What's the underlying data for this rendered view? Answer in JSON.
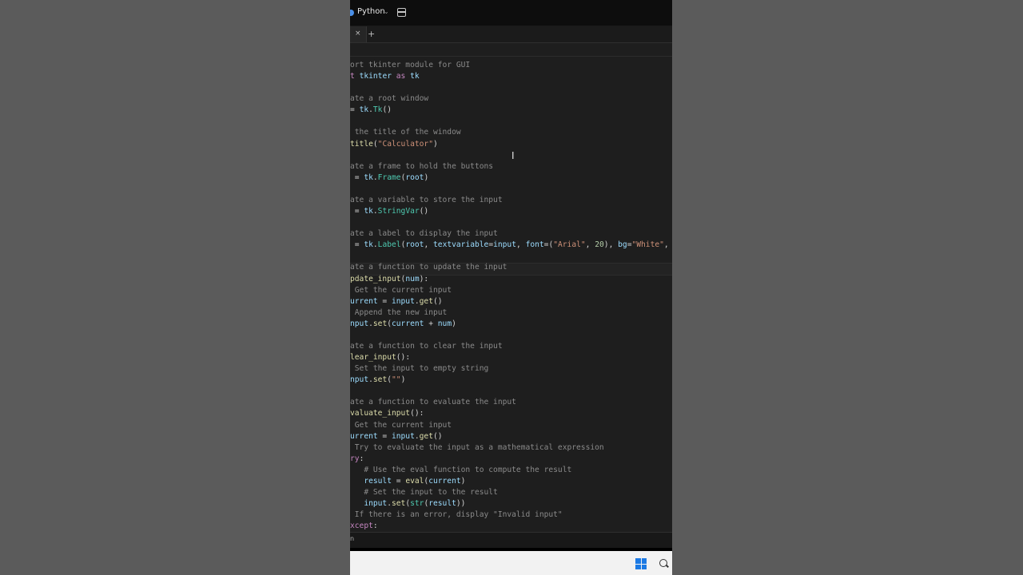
{
  "window": {
    "language": "Python",
    "tab_close": "×",
    "tab_add": "+"
  },
  "statusbar": {
    "text": "n"
  },
  "editor": {
    "lines": [
      [
        {
          "t": "ort tkinter module for GUI",
          "c": "comment"
        }
      ],
      [
        {
          "t": "t ",
          "c": "kw"
        },
        {
          "t": "tkinter",
          "c": "id"
        },
        {
          "t": " as ",
          "c": "kw"
        },
        {
          "t": "tk",
          "c": "id"
        }
      ],
      [
        {
          "t": "",
          "c": "id"
        }
      ],
      [
        {
          "t": "ate a root window",
          "c": "comment"
        }
      ],
      [
        {
          "t": "= ",
          "c": "plain"
        },
        {
          "t": "tk",
          "c": "id"
        },
        {
          "t": ".",
          "c": "plain"
        },
        {
          "t": "Tk",
          "c": "cls"
        },
        {
          "t": "()",
          "c": "plain"
        }
      ],
      [
        {
          "t": "",
          "c": "id"
        }
      ],
      [
        {
          "t": " the title of the window",
          "c": "comment"
        }
      ],
      [
        {
          "t": "title",
          "c": "fn"
        },
        {
          "t": "(",
          "c": "plain"
        },
        {
          "t": "\"Calculator\"",
          "c": "str"
        },
        {
          "t": ")",
          "c": "plain"
        }
      ],
      [
        {
          "t": "",
          "c": "id"
        }
      ],
      [
        {
          "t": "ate a frame to hold the buttons",
          "c": "comment"
        }
      ],
      [
        {
          "t": " = ",
          "c": "plain"
        },
        {
          "t": "tk",
          "c": "id"
        },
        {
          "t": ".",
          "c": "plain"
        },
        {
          "t": "Frame",
          "c": "cls"
        },
        {
          "t": "(",
          "c": "plain"
        },
        {
          "t": "root",
          "c": "id"
        },
        {
          "t": ")",
          "c": "plain"
        }
      ],
      [
        {
          "t": "",
          "c": "id"
        }
      ],
      [
        {
          "t": "ate a variable to store the input",
          "c": "comment"
        }
      ],
      [
        {
          "t": " = ",
          "c": "plain"
        },
        {
          "t": "tk",
          "c": "id"
        },
        {
          "t": ".",
          "c": "plain"
        },
        {
          "t": "StringVar",
          "c": "cls"
        },
        {
          "t": "()",
          "c": "plain"
        }
      ],
      [
        {
          "t": "",
          "c": "id"
        }
      ],
      [
        {
          "t": "ate a label to display the input",
          "c": "comment"
        }
      ],
      [
        {
          "t": " = ",
          "c": "plain"
        },
        {
          "t": "tk",
          "c": "id"
        },
        {
          "t": ".",
          "c": "plain"
        },
        {
          "t": "Label",
          "c": "cls"
        },
        {
          "t": "(",
          "c": "plain"
        },
        {
          "t": "root",
          "c": "id"
        },
        {
          "t": ", ",
          "c": "plain"
        },
        {
          "t": "textvariable",
          "c": "param"
        },
        {
          "t": "=",
          "c": "plain"
        },
        {
          "t": "input",
          "c": "id"
        },
        {
          "t": ", ",
          "c": "plain"
        },
        {
          "t": "font",
          "c": "param"
        },
        {
          "t": "=(",
          "c": "plain"
        },
        {
          "t": "\"Arial\"",
          "c": "str"
        },
        {
          "t": ", ",
          "c": "plain"
        },
        {
          "t": "20",
          "c": "num"
        },
        {
          "t": "), ",
          "c": "plain"
        },
        {
          "t": "bg",
          "c": "param"
        },
        {
          "t": "=",
          "c": "plain"
        },
        {
          "t": "\"White\"",
          "c": "str"
        },
        {
          "t": ", an",
          "c": "plain"
        }
      ],
      [
        {
          "t": "",
          "c": "id"
        }
      ],
      [
        {
          "t": "ate a function to update the input",
          "c": "comment"
        }
      ],
      [
        {
          "t": "pdate_input",
          "c": "fn"
        },
        {
          "t": "(",
          "c": "plain"
        },
        {
          "t": "num",
          "c": "id"
        },
        {
          "t": "):",
          "c": "plain"
        }
      ],
      [
        {
          "t": " Get the current input",
          "c": "comment"
        }
      ],
      [
        {
          "t": "urrent",
          "c": "id"
        },
        {
          "t": " = ",
          "c": "plain"
        },
        {
          "t": "input",
          "c": "id"
        },
        {
          "t": ".",
          "c": "plain"
        },
        {
          "t": "get",
          "c": "fn"
        },
        {
          "t": "()",
          "c": "plain"
        }
      ],
      [
        {
          "t": " Append the new input",
          "c": "comment"
        }
      ],
      [
        {
          "t": "nput",
          "c": "id"
        },
        {
          "t": ".",
          "c": "plain"
        },
        {
          "t": "set",
          "c": "fn"
        },
        {
          "t": "(",
          "c": "plain"
        },
        {
          "t": "current",
          "c": "id"
        },
        {
          "t": " + ",
          "c": "plain"
        },
        {
          "t": "num",
          "c": "id"
        },
        {
          "t": ")",
          "c": "plain"
        }
      ],
      [
        {
          "t": "",
          "c": "id"
        }
      ],
      [
        {
          "t": "ate a function to clear the input",
          "c": "comment"
        }
      ],
      [
        {
          "t": "lear_input",
          "c": "fn"
        },
        {
          "t": "():",
          "c": "plain"
        }
      ],
      [
        {
          "t": " Set the input to empty string",
          "c": "comment"
        }
      ],
      [
        {
          "t": "nput",
          "c": "id"
        },
        {
          "t": ".",
          "c": "plain"
        },
        {
          "t": "set",
          "c": "fn"
        },
        {
          "t": "(",
          "c": "plain"
        },
        {
          "t": "\"\"",
          "c": "str"
        },
        {
          "t": ")",
          "c": "plain"
        }
      ],
      [
        {
          "t": "",
          "c": "id"
        }
      ],
      [
        {
          "t": "ate a function to evaluate the input",
          "c": "comment"
        }
      ],
      [
        {
          "t": "valuate_input",
          "c": "fn"
        },
        {
          "t": "():",
          "c": "plain"
        }
      ],
      [
        {
          "t": " Get the current input",
          "c": "comment"
        }
      ],
      [
        {
          "t": "urrent",
          "c": "id"
        },
        {
          "t": " = ",
          "c": "plain"
        },
        {
          "t": "input",
          "c": "id"
        },
        {
          "t": ".",
          "c": "plain"
        },
        {
          "t": "get",
          "c": "fn"
        },
        {
          "t": "()",
          "c": "plain"
        }
      ],
      [
        {
          "t": " Try to evaluate the input as a mathematical expression",
          "c": "comment"
        }
      ],
      [
        {
          "t": "ry",
          "c": "kw"
        },
        {
          "t": ":",
          "c": "plain"
        }
      ],
      [
        {
          "t": "   # Use the eval function to compute the result",
          "c": "comment"
        }
      ],
      [
        {
          "t": "   ",
          "c": "plain"
        },
        {
          "t": "result",
          "c": "id"
        },
        {
          "t": " = ",
          "c": "plain"
        },
        {
          "t": "eval",
          "c": "fn"
        },
        {
          "t": "(",
          "c": "plain"
        },
        {
          "t": "current",
          "c": "id"
        },
        {
          "t": ")",
          "c": "plain"
        }
      ],
      [
        {
          "t": "   # Set the input to the result",
          "c": "comment"
        }
      ],
      [
        {
          "t": "   ",
          "c": "plain"
        },
        {
          "t": "input",
          "c": "id"
        },
        {
          "t": ".",
          "c": "plain"
        },
        {
          "t": "set",
          "c": "fn"
        },
        {
          "t": "(",
          "c": "plain"
        },
        {
          "t": "str",
          "c": "cls"
        },
        {
          "t": "(",
          "c": "plain"
        },
        {
          "t": "result",
          "c": "id"
        },
        {
          "t": "))",
          "c": "plain"
        }
      ],
      [
        {
          "t": " If there is an error, display \"Invalid input\"",
          "c": "comment"
        }
      ],
      [
        {
          "t": "xcept",
          "c": "kw"
        },
        {
          "t": ":",
          "c": "plain"
        }
      ]
    ]
  },
  "colors": {
    "comment": "#8a8a8a",
    "kw": "#c586c0",
    "id": "#9cdcfe",
    "fn": "#dcdcaa",
    "cls": "#4ec9b0",
    "str": "#ce9178",
    "num": "#b5cea8",
    "param": "#9cdcfe",
    "plain": "#d4d4d4"
  }
}
